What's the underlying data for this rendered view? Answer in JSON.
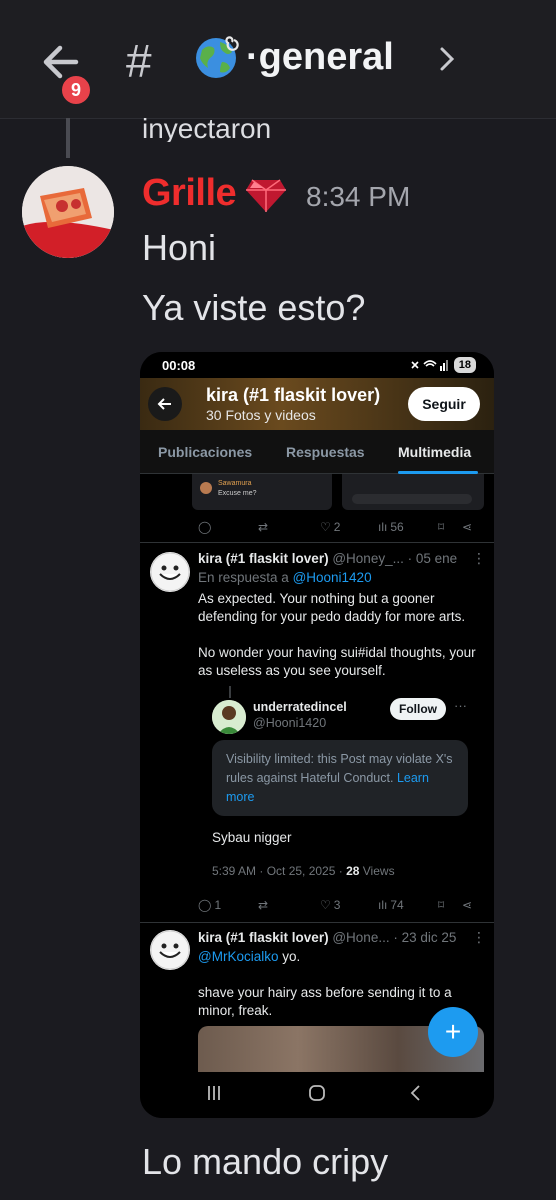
{
  "header": {
    "notification_count": "9",
    "channel_name": "·general",
    "icons": [
      "back-arrow-icon",
      "hash-icon",
      "globe-icon",
      "swirl-icon",
      "chevron-right-icon"
    ]
  },
  "previous_message": {
    "text": "inyectaron"
  },
  "message": {
    "author": "Grille",
    "author_color": "#ef2d2d",
    "time": "8:34 PM",
    "lines": [
      "Honi",
      "Ya viste esto?"
    ],
    "followup": "Lo mando cripy"
  },
  "screenshot": {
    "status_bar": {
      "time": "00:08",
      "battery": "18"
    },
    "profile": {
      "name": "kira (#1 flaskit lover)",
      "subtitle": "30 Fotos y videos",
      "follow_label": "Seguir"
    },
    "tabs": [
      "Publicaciones",
      "Respuestas",
      "Multimedia"
    ],
    "active_tab": "Multimedia",
    "mini_card": {
      "user": "Sawamura",
      "text": "Excuse me?"
    },
    "post0_stats": {
      "likes": "2",
      "views": "56"
    },
    "post1": {
      "name": "kira (#1 flaskit lover)",
      "meta": "@Honey_... · 05 ene",
      "reply_prefix": "En respuesta a ",
      "reply_to": "@Hooni1420",
      "body1": "As expected. Your nothing but a gooner defending for your pedo daddy for more arts.",
      "body2": "No wonder your having sui#idal thoughts, your as useless as you see yourself.",
      "stats": {
        "replies": "1",
        "likes": "3",
        "views": "74"
      }
    },
    "quoted": {
      "name": "underratedincel",
      "handle": "@Hooni1420",
      "follow_label": "Follow",
      "notice": "Visibility limited: this Post may violate X's rules against Hateful Conduct. ",
      "notice_link": "Learn more",
      "text": "Sybau nigger",
      "stamp": "5:39 AM · Oct 25, 2025 · ",
      "views_count": "28",
      "views_label": " Views"
    },
    "post2": {
      "name": "kira (#1 flaskit lover)",
      "meta": "@Hone... · 23 dic 25",
      "mention": "@MrKocialko",
      "mention_rest": " yo.",
      "body": "shave your hairy ass before sending it to a minor, freak."
    }
  }
}
